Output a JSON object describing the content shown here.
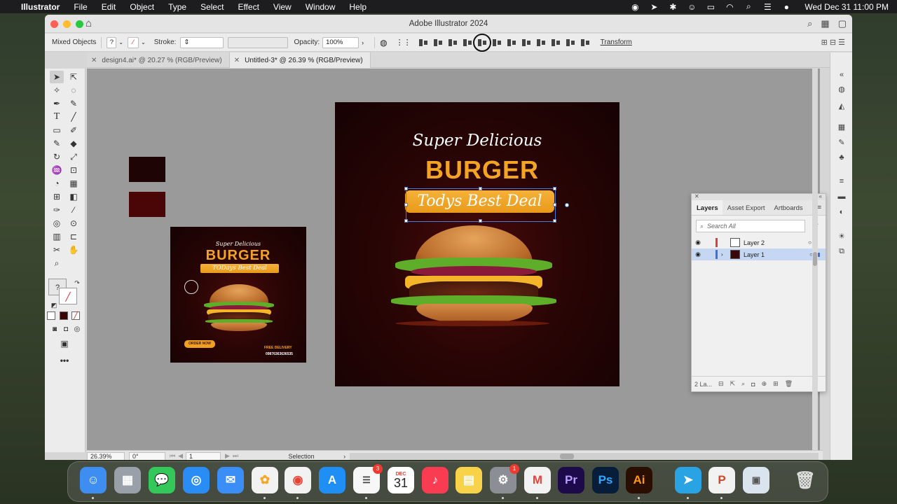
{
  "menubar": {
    "app_name": "Illustrator",
    "items": [
      "File",
      "Edit",
      "Object",
      "Type",
      "Select",
      "Effect",
      "View",
      "Window",
      "Help"
    ],
    "clock": "Wed Dec 31  11:00 PM"
  },
  "window": {
    "title": "Adobe Illustrator 2024"
  },
  "control_bar": {
    "selection_label": "Mixed Objects",
    "fill_value": "?",
    "stroke_label": "Stroke:",
    "opacity_label": "Opacity:",
    "opacity_value": "100%",
    "transform_label": "Transform"
  },
  "tabs": [
    {
      "label": "design4.ai* @ 20.27 % (RGB/Preview)",
      "active": false
    },
    {
      "label": "Untitled-3* @ 26.39 % (RGB/Preview)",
      "active": true
    }
  ],
  "toolbar": {
    "fill_indicator": "?"
  },
  "artboard_main": {
    "script_heading": "Super Delicious",
    "title": "BURGER",
    "pill_text": "Todys Best Deal"
  },
  "artboard_small": {
    "script_heading": "Super Delicious",
    "title": "BURGER",
    "pill_text": "TODays Best Deal",
    "order_label": "ORDER NOW",
    "delivery_label": "FREE DELIVERY",
    "phone": "09876363636535"
  },
  "swatches": {
    "colors": [
      "#1e0404",
      "#4a0606"
    ]
  },
  "layers_panel": {
    "tabs": [
      "Layers",
      "Asset Export",
      "Artboards"
    ],
    "search_placeholder": "Search All",
    "layers": [
      {
        "name": "Layer 2",
        "color": "#e23b3b",
        "selected": false
      },
      {
        "name": "Layer 1",
        "color": "#3b6fe2",
        "selected": true
      }
    ],
    "footer_count": "2 La..."
  },
  "status_bar": {
    "zoom": "26.39%",
    "rotation": "0°",
    "artboard_number": "1",
    "tool_name": "Selection"
  },
  "dock": {
    "apps": [
      {
        "name": "Finder",
        "icon": "finder-icon",
        "color": "#3d8ef0"
      },
      {
        "name": "Launchpad",
        "icon": "launchpad-icon",
        "color": "#9aa0a8"
      },
      {
        "name": "Messages",
        "icon": "messages-icon",
        "color": "#34c759"
      },
      {
        "name": "Safari",
        "icon": "safari-icon",
        "color": "#2a8cf5"
      },
      {
        "name": "Mail",
        "icon": "mail-icon",
        "color": "#3a8ef6"
      },
      {
        "name": "Photos",
        "icon": "photos-icon",
        "color": "#f2f2f2"
      },
      {
        "name": "Chrome",
        "icon": "chrome-icon",
        "color": "#f2f2f2"
      },
      {
        "name": "App Store",
        "icon": "appstore-icon",
        "color": "#1f8ef5"
      },
      {
        "name": "Reminders",
        "icon": "reminders-icon",
        "color": "#f7f7f7",
        "badge": "3"
      },
      {
        "name": "Calendar",
        "icon": "calendar-icon",
        "color": "#ffffff",
        "month": "DEC",
        "day": "31"
      },
      {
        "name": "Music",
        "icon": "music-icon",
        "color": "#fa3c52"
      },
      {
        "name": "Notes",
        "icon": "notes-icon",
        "color": "#f8d34a"
      },
      {
        "name": "System Settings",
        "icon": "settings-icon",
        "color": "#8b8f95",
        "badge": "1"
      },
      {
        "name": "Gmail",
        "icon": "gmail-icon",
        "color": "#f2f2f2"
      },
      {
        "name": "Premiere Pro",
        "icon": "premiere-icon",
        "color": "#1c0a4a",
        "label": "Pr"
      },
      {
        "name": "Photoshop",
        "icon": "photoshop-icon",
        "color": "#061e3a",
        "label": "Ps"
      },
      {
        "name": "Illustrator",
        "icon": "illustrator-icon",
        "color": "#2a0f00",
        "label": "Ai"
      },
      {
        "name": "Telegram",
        "icon": "telegram-icon",
        "color": "#2aa3e4"
      },
      {
        "name": "PowerPoint",
        "icon": "powerpoint-icon",
        "color": "#f2f2f2"
      },
      {
        "name": "Preview",
        "icon": "preview-icon",
        "color": "#d9e4ef"
      },
      {
        "name": "Trash",
        "icon": "trash-icon",
        "color": "transparent"
      }
    ]
  }
}
